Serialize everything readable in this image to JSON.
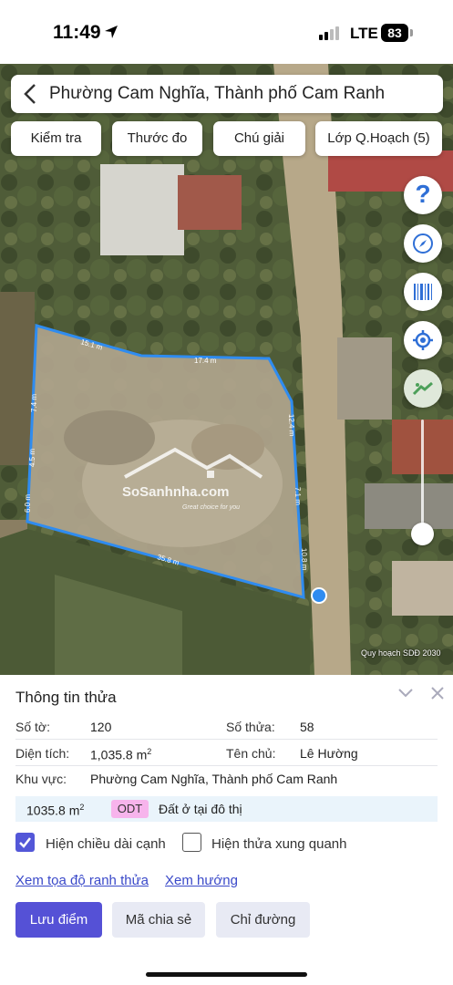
{
  "status_bar": {
    "time": "11:49",
    "network": "LTE",
    "battery": "83"
  },
  "header": {
    "title": "Phường Cam Nghĩa, Thành phố Cam Ranh"
  },
  "toolbar": [
    {
      "label": "Kiểm tra"
    },
    {
      "label": "Thước đo"
    },
    {
      "label": "Chú giải"
    },
    {
      "label": "Lớp Q.Hoạch (5)"
    }
  ],
  "side_buttons": [
    "help-icon",
    "compass-icon",
    "barcode-icon",
    "locate-icon",
    "map-layer-icon"
  ],
  "map": {
    "edge_labels": [
      "15.1 m",
      "17.4 m",
      "7.4 m",
      "4.5 m",
      "6.0 m",
      "12.4 m",
      "7.1 m",
      "10.8 m",
      "35.8 m"
    ],
    "watermark": "SoSanhnha.com",
    "watermark_sub": "Great choice for you",
    "credit": "Quy hoạch SDĐ 2030",
    "boundary_color": "#2f8cf0"
  },
  "panel": {
    "title": "Thông tin thửa",
    "so_to_label": "Số tờ:",
    "so_to_value": "120",
    "so_thua_label": "Số thửa:",
    "so_thua_value": "58",
    "dien_tich_label": "Diện tích:",
    "dien_tich_value": "1,035.8 m",
    "ten_chu_label": "Tên chủ:",
    "ten_chu_value": "Lê Hường",
    "khu_vuc_label": "Khu vực:",
    "khu_vuc_value": "Phường Cam Nghĩa, Thành phố Cam Ranh",
    "area_zone": "1035.8 m",
    "zone_code": "ODT",
    "zone_desc": "Đất ở tại đô thị",
    "zone_color": "#f7b4ec",
    "checkbox_edge_label": "Hiện chiều dài cạnh",
    "checkbox_edge_checked": true,
    "checkbox_neighbor_label": "Hiện thửa xung quanh",
    "checkbox_neighbor_checked": false,
    "link_coords": "Xem tọa độ ranh thửa",
    "link_direction": "Xem hướng",
    "btn_save": "Lưu điểm",
    "btn_share": "Mã chia sẻ",
    "btn_route": "Chỉ đường"
  }
}
